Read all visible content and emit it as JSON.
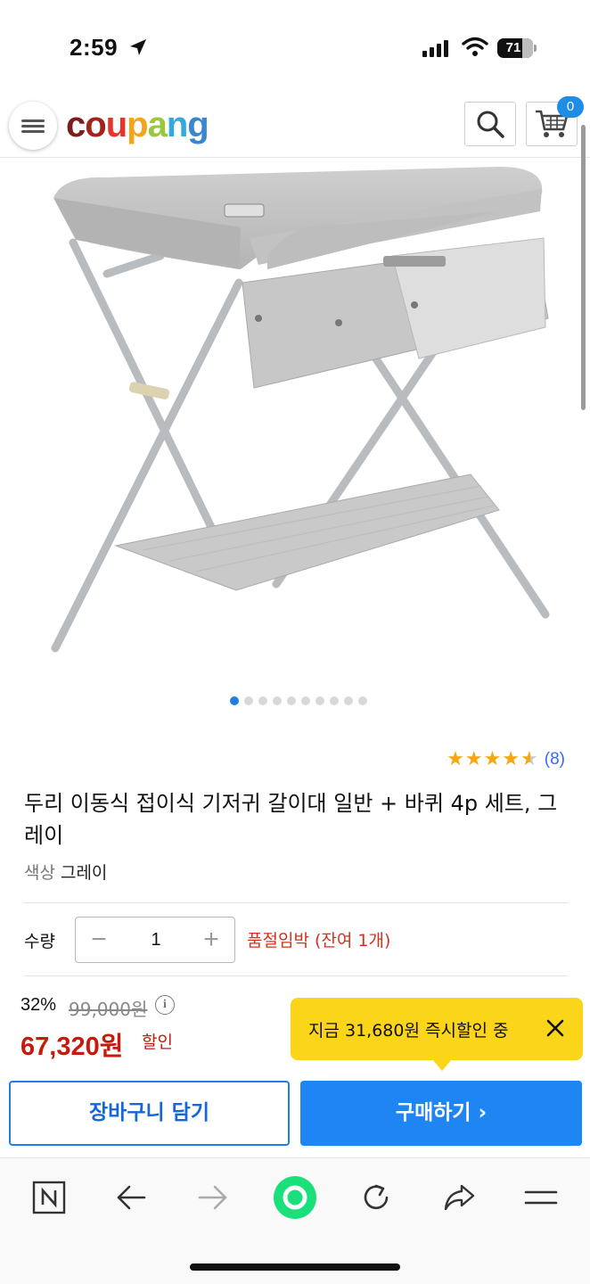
{
  "status_bar": {
    "time": "2:59",
    "battery": "71"
  },
  "header": {
    "logo_letters": [
      "c",
      "o",
      "u",
      "p",
      "a",
      "n",
      "g",
      ""
    ],
    "cart_count": "0",
    "icons": [
      "menu-icon",
      "search-icon",
      "cart-icon"
    ]
  },
  "gallery": {
    "dot_count": 10,
    "active_index": 0
  },
  "product": {
    "rating_stars": 4.5,
    "review_count": "(8)",
    "title": "두리 이동식 접이식 기저귀 갈이대 일반 + 바퀴 4p 세트, 그레이",
    "option_key": "색상",
    "option_value": "그레이"
  },
  "quantity": {
    "label": "수량",
    "minus": "−",
    "value": "1",
    "plus": "+",
    "stock_warning": "품절임박 (잔여 1개)"
  },
  "price": {
    "discount_rate": "32%",
    "original": "99,000원",
    "info": "i",
    "sale": "67,320원",
    "sale_suffix": "할인"
  },
  "coupon_tip": {
    "text": "지금 31,680원 즉시할인 중"
  },
  "actions": {
    "cart_label": "장바구니 담기",
    "buy_label": "구매하기 ›"
  },
  "colors": {
    "brand_blue": "#1e85f2",
    "sale_red": "#c61a0c",
    "tip_yellow": "#fbd51a",
    "star": "#f5a70f"
  },
  "browser_toolbar": {
    "icons": [
      "naver-n-icon",
      "back-arrow-icon",
      "forward-arrow-icon",
      "green-dot-icon",
      "reload-icon",
      "share-icon",
      "menu-icon"
    ]
  }
}
